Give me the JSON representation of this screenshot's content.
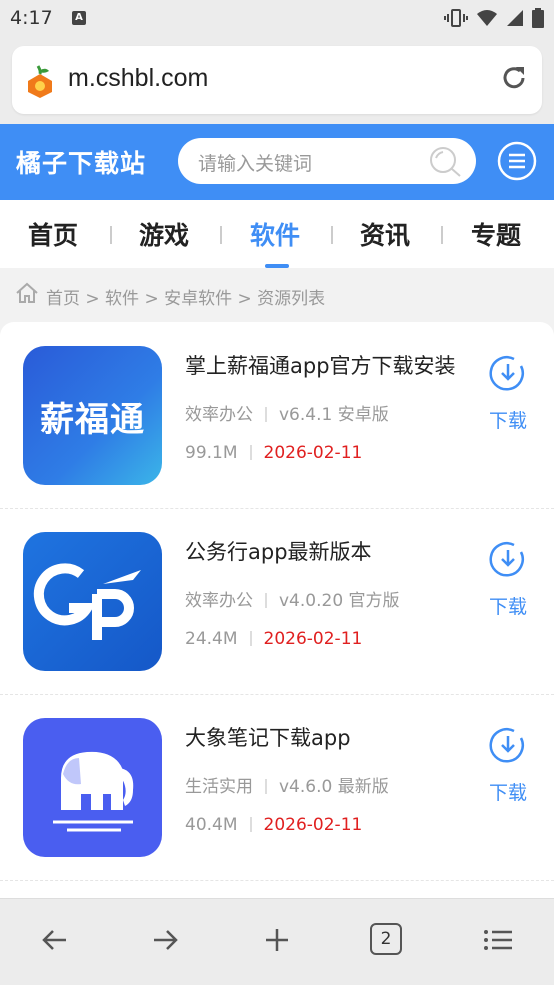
{
  "status": {
    "time": "4:17",
    "a_badge": "A"
  },
  "browser": {
    "url": "m.cshbl.com",
    "tabs_count": "2"
  },
  "site": {
    "name": "橘子下载站",
    "search_placeholder": "请输入关键词"
  },
  "nav": {
    "tabs": [
      {
        "label": "首页"
      },
      {
        "label": "游戏"
      },
      {
        "label": "软件"
      },
      {
        "label": "资讯"
      },
      {
        "label": "专题"
      }
    ],
    "active": "软件"
  },
  "breadcrumb": "首页 > 软件 > 安卓软件 > 资源列表",
  "apps": [
    {
      "title": "掌上薪福通app官方下载安装",
      "category": "效率办公",
      "version": "v6.4.1 安卓版",
      "size": "99.1M",
      "date": "2026-02-11",
      "download": "下载",
      "icon_text": "薪福通"
    },
    {
      "title": "公务行app最新版本",
      "category": "效率办公",
      "version": "v4.0.20 官方版",
      "size": "24.4M",
      "date": "2026-02-11",
      "download": "下载",
      "icon_text": "GP"
    },
    {
      "title": "大象笔记下载app",
      "category": "生活实用",
      "version": "v4.6.0 最新版",
      "size": "40.4M",
      "date": "2026-02-11",
      "download": "下载",
      "icon_text": ""
    }
  ],
  "colors": {
    "accent": "#3f8ef5",
    "date": "#e02020",
    "muted": "#999999"
  }
}
